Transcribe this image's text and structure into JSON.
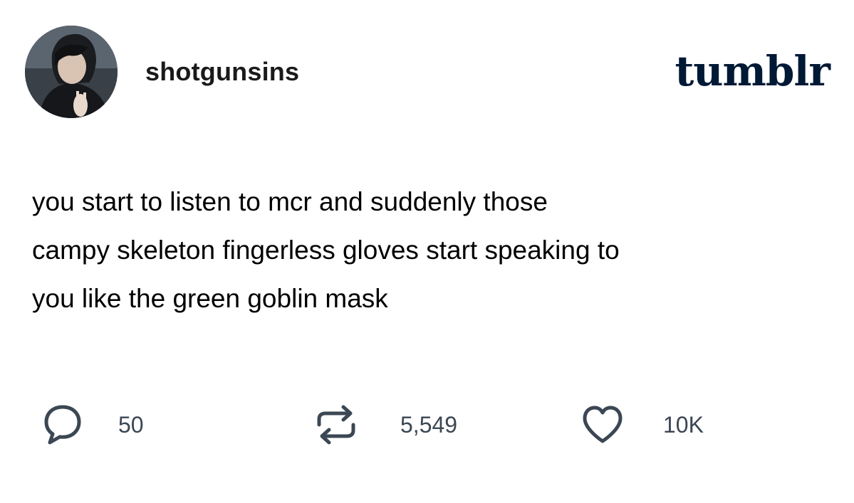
{
  "post": {
    "username": "shotgunsins",
    "brand": "tumblr",
    "body_lines": [
      "you start to listen to mcr and suddenly those",
      "campy skeleton fingerless gloves start speaking to",
      "you like the green goblin mask"
    ]
  },
  "actions": {
    "replies": {
      "icon": "speech-bubble-icon",
      "count": "50"
    },
    "reblogs": {
      "icon": "reblog-arrows-icon",
      "count": "5,549"
    },
    "likes": {
      "icon": "heart-icon",
      "count": "10K"
    }
  },
  "colors": {
    "brand": "#001935",
    "icon": "#3b4753",
    "text": "#000000",
    "background": "#ffffff"
  }
}
